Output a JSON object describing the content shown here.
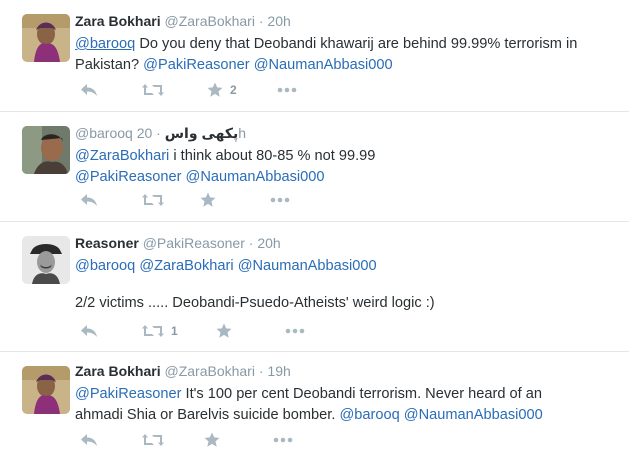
{
  "tweets": [
    {
      "fullname": "Zara Bokhari",
      "handle": "@ZaraBokhari",
      "sep": "·",
      "time": "20h",
      "line1": [
        {
          "t": "@barooq",
          "mention": true,
          "underline": true
        },
        {
          "t": " Do you deny that Deobandi khawarij are behind 99.99% terrorism in",
          "mention": false
        }
      ],
      "line2": [
        {
          "t": "Pakistan?  ",
          "mention": false
        },
        {
          "t": "@PakiReasoner",
          "mention": true
        },
        {
          "t": " ",
          "mention": false
        },
        {
          "t": "@NaumanAbbasi000",
          "mention": true
        }
      ],
      "favorite_count": "2",
      "retweet_count": ""
    },
    {
      "fullname": "",
      "handle": "@barooq",
      "urdu_name": "پکھی واس",
      "sep": "·",
      "time": "20h",
      "line1": [
        {
          "t": "@ZaraBokhari",
          "mention": true
        },
        {
          "t": "  i think about 80-85 % not 99.99",
          "mention": false
        }
      ],
      "line2": [
        {
          "t": "@PakiReasoner",
          "mention": true
        },
        {
          "t": " ",
          "mention": false
        },
        {
          "t": "@NaumanAbbasi000",
          "mention": true
        }
      ],
      "favorite_count": "",
      "retweet_count": ""
    },
    {
      "fullname": "Reasoner",
      "handle": "@PakiReasoner",
      "sep": "·",
      "time": "20h",
      "line1": [
        {
          "t": "@barooq",
          "mention": true
        },
        {
          "t": " ",
          "mention": false
        },
        {
          "t": "@ZaraBokhari",
          "mention": true
        },
        {
          "t": " ",
          "mention": false
        },
        {
          "t": "@NaumanAbbasi000",
          "mention": true
        }
      ],
      "line2": [],
      "line3": "2/2 victims ..... Deobandi-Psuedo-Atheists' weird logic :)",
      "favorite_count": "",
      "retweet_count": "1"
    },
    {
      "fullname": "Zara Bokhari",
      "handle": "@ZaraBokhari",
      "sep": "·",
      "time": "19h",
      "line1": [
        {
          "t": "@PakiReasoner",
          "mention": true
        },
        {
          "t": " It's 100 per cent Deobandi terrorism.  Never heard of an",
          "mention": false
        }
      ],
      "line2": [
        {
          "t": "ahmadi Shia or Barelvis suicide bomber. ",
          "mention": false
        },
        {
          "t": "@barooq",
          "mention": true
        },
        {
          "t": " ",
          "mention": false
        },
        {
          "t": "@NaumanAbbasi000",
          "mention": true
        }
      ],
      "favorite_count": "",
      "retweet_count": ""
    }
  ],
  "icons": {
    "reply": "reply-icon",
    "retweet": "retweet-icon",
    "favorite": "star-icon",
    "more": "more-icon"
  },
  "colors": {
    "link": "#2a6db8",
    "muted": "#8899a6",
    "icon": "#aab8c2",
    "divider": "#e1e8ed"
  }
}
